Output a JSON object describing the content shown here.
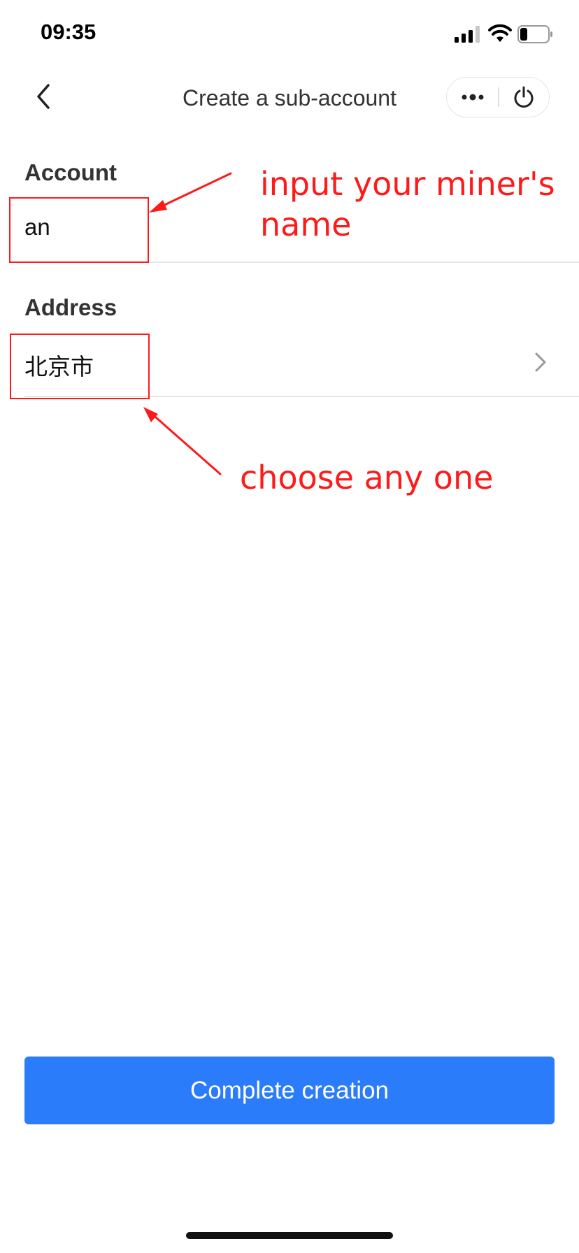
{
  "status_bar": {
    "time": "09:35"
  },
  "nav": {
    "title": "Create a sub-account"
  },
  "form": {
    "account": {
      "label": "Account",
      "value": "an"
    },
    "address": {
      "label": "Address",
      "value": "北京市"
    }
  },
  "annotations": {
    "account_note_line1": "input your miner's",
    "account_note_line2": "name",
    "address_note": "choose any one",
    "color": "#ff1a1a"
  },
  "actions": {
    "complete_label": "Complete creation"
  },
  "colors": {
    "primary_button": "#2a7cfb",
    "title_text": "#333333"
  },
  "icons": {
    "back": "chevron-left-icon",
    "more": "more-dots-icon",
    "power": "power-icon",
    "address_chevron": "chevron-right-icon",
    "signal": "cellular-signal-icon",
    "wifi": "wifi-icon",
    "battery": "battery-icon"
  }
}
